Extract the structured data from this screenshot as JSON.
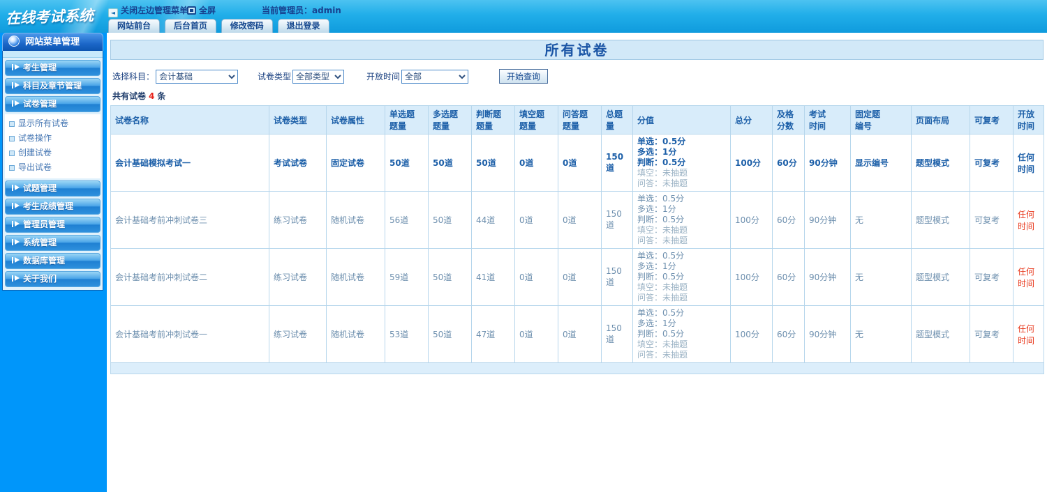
{
  "colors": {
    "topbar_blue": "#21aee9",
    "sidebar_blue": "#0096fa",
    "header_bg": "#d8ecfa",
    "title_bg": "#d2e9f8",
    "accent_text": "#1c5fa8",
    "alert_red": "#e8391d"
  },
  "logo": {
    "title": "在线考试系统"
  },
  "topbar": {
    "close_menu_label": "关闭左边管理菜单",
    "fullscreen_label": "全屏",
    "admin_label": "当前管理员：admin",
    "tabs": [
      {
        "label": "网站前台"
      },
      {
        "label": "后台首页"
      },
      {
        "label": "修改密码"
      },
      {
        "label": "退出登录"
      }
    ]
  },
  "sidebar": {
    "header": "网站菜单管理",
    "groups": {
      "g0": "考生管理",
      "g1": "科目及章节管理",
      "g2": "试卷管理",
      "g3": "试题管理",
      "g4": "考生成绩管理",
      "g5": "管理员管理",
      "g6": "系统管理",
      "g7": "数据库管理",
      "g8": "关于我们"
    },
    "paper_children": {
      "c0": "显示所有试卷",
      "c1": "试卷操作",
      "c2": "创建试卷",
      "c3": "导出试卷"
    }
  },
  "main": {
    "title": "所有试卷",
    "filters": {
      "subject_label": "选择科目：",
      "subject_value": "会计基础",
      "type_label": "试卷类型",
      "type_value": "全部类型",
      "time_label": "开放时间",
      "time_value": "全部",
      "query_button": "开始查询"
    },
    "count": {
      "prefix": "共有试卷",
      "value": "4",
      "suffix": "条"
    },
    "table": {
      "headers": {
        "h0": "试卷名称",
        "h1": "试卷类型",
        "h2": "试卷属性",
        "h3": "单选题\n题量",
        "h4": "多选题\n题量",
        "h5": "判断题\n题量",
        "h6": "填空题\n题量",
        "h7": "问答题\n题量",
        "h8": "总题量",
        "h9": "分值",
        "h10": "总分",
        "h11": "及格\n分数",
        "h12": "考试\n时间",
        "h13": "固定题\n编号",
        "h14": "页面布局",
        "h15": "可复考",
        "h16": "开放时间"
      },
      "rows": [
        {
          "name": "会计基础模拟考试一",
          "type": "考试试卷",
          "attr": "固定试卷",
          "single": "50道",
          "multi": "50道",
          "judge": "50道",
          "fill": "0道",
          "qa": "0道",
          "total": "150道",
          "score_lines": [
            "单选：0.5分",
            "多选：1分",
            "判断：0.5分",
            "填空：未抽题",
            "问答：未抽题"
          ],
          "total_score": "100分",
          "pass_score": "60分",
          "exam_time": "90分钟",
          "fixed_no": "显示编号",
          "layout": "题型模式",
          "retake": "可复考",
          "open_time": "任何时间",
          "emphasis": true
        },
        {
          "name": "会计基础考前冲刺试卷三",
          "type": "练习试卷",
          "attr": "随机试卷",
          "single": "56道",
          "multi": "50道",
          "judge": "44道",
          "fill": "0道",
          "qa": "0道",
          "total": "150道",
          "score_lines": [
            "单选：0.5分",
            "多选：1分",
            "判断：0.5分",
            "填空：未抽题",
            "问答：未抽题"
          ],
          "total_score": "100分",
          "pass_score": "60分",
          "exam_time": "90分钟",
          "fixed_no": "无",
          "layout": "题型模式",
          "retake": "可复考",
          "open_time": "任何时间",
          "emphasis": false
        },
        {
          "name": "会计基础考前冲刺试卷二",
          "type": "练习试卷",
          "attr": "随机试卷",
          "single": "59道",
          "multi": "50道",
          "judge": "41道",
          "fill": "0道",
          "qa": "0道",
          "total": "150道",
          "score_lines": [
            "单选：0.5分",
            "多选：1分",
            "判断：0.5分",
            "填空：未抽题",
            "问答：未抽题"
          ],
          "total_score": "100分",
          "pass_score": "60分",
          "exam_time": "90分钟",
          "fixed_no": "无",
          "layout": "题型模式",
          "retake": "可复考",
          "open_time": "任何时间",
          "emphasis": false
        },
        {
          "name": "会计基础考前冲刺试卷一",
          "type": "练习试卷",
          "attr": "随机试卷",
          "single": "53道",
          "multi": "50道",
          "judge": "47道",
          "fill": "0道",
          "qa": "0道",
          "total": "150道",
          "score_lines": [
            "单选：0.5分",
            "多选：1分",
            "判断：0.5分",
            "填空：未抽题",
            "问答：未抽题"
          ],
          "total_score": "100分",
          "pass_score": "60分",
          "exam_time": "90分钟",
          "fixed_no": "无",
          "layout": "题型模式",
          "retake": "可复考",
          "open_time": "任何时间",
          "emphasis": false
        }
      ]
    }
  }
}
